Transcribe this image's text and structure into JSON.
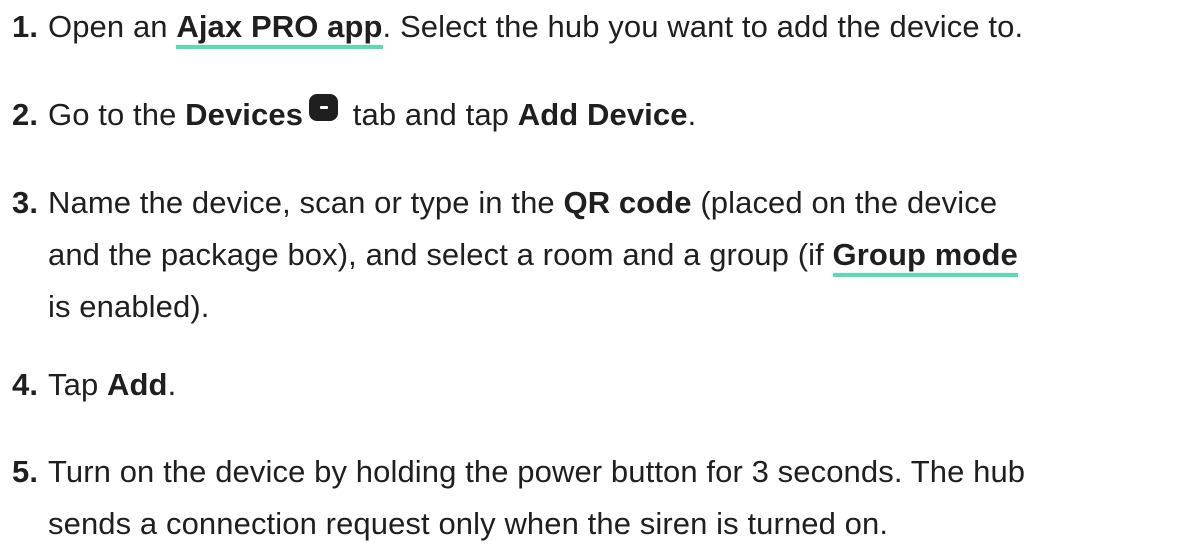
{
  "steps": [
    {
      "number": "1.",
      "t1": "Open an ",
      "link1": "Ajax PRO app",
      "t2": ". Select the hub you want to add the device to."
    },
    {
      "number": "2.",
      "t1": "Go to the ",
      "b1": "Devices",
      "icon": "devices-tab-icon",
      "t2": " tab and tap ",
      "b2": "Add Device",
      "t3": "."
    },
    {
      "number": "3.",
      "t1": "Name the device, scan or type in the ",
      "b1": "QR code",
      "t2": " (placed on the device",
      "t3": "and the package box), and select a room and a group (if ",
      "link1": "Group mode",
      "t4": "is enabled)."
    },
    {
      "number": "4.",
      "t1": "Tap ",
      "b1": "Add",
      "t2": "."
    },
    {
      "number": "5.",
      "t1": "Turn on the device by holding the power button for 3 seconds. The hub",
      "t2": "sends a connection request only when the siren is turned on."
    }
  ],
  "colors": {
    "text": "#1f1f1f",
    "link_underline": "#59dcb0",
    "background": "#ffffff"
  }
}
